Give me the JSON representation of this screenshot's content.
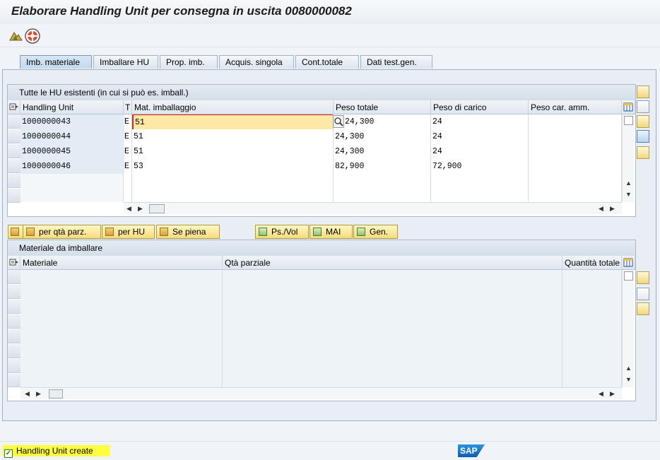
{
  "window": {
    "title": "Elaborare Handling Unit per consegna in uscita 0080000082"
  },
  "toolbar": {
    "icons": [
      "mountain-icon",
      "lifebuoy-icon"
    ]
  },
  "tabs": [
    {
      "label": "Imb. materiale",
      "active": true
    },
    {
      "label": "Imballare HU"
    },
    {
      "label": "Prop. imb."
    },
    {
      "label": "Acquis. singola"
    },
    {
      "label": "Cont.totale"
    },
    {
      "label": "Dati test.gen."
    }
  ],
  "hu_table": {
    "title": "Tutte le HU esistenti (in cui si può es. imball.)",
    "columns": [
      "Handling Unit",
      "T",
      "Mat. imballaggio",
      "Peso totale",
      "Peso di carico",
      "Peso car. amm."
    ],
    "rows": [
      {
        "hu": "1000000043",
        "t": "E",
        "mat": "51",
        "peso_totale": "24,300",
        "peso_carico": "24",
        "peso_amm": ""
      },
      {
        "hu": "1000000044",
        "t": "E",
        "mat": "51",
        "peso_totale": "24,300",
        "peso_carico": "24",
        "peso_amm": ""
      },
      {
        "hu": "1000000045",
        "t": "E",
        "mat": "51",
        "peso_totale": "24,300",
        "peso_carico": "24",
        "peso_amm": ""
      },
      {
        "hu": "1000000046",
        "t": "E",
        "mat": "53",
        "peso_totale": "82,900",
        "peso_carico": "72,900",
        "peso_amm": ""
      }
    ]
  },
  "buttons": {
    "per_qta_parz": "per qtà parz.",
    "per_hu": "per HU",
    "se_piena": "Se piena",
    "ps_vol": "Ps./Vol",
    "mai": "MAI",
    "gen": "Gen."
  },
  "mat_table": {
    "title": "Materiale da imballare",
    "columns": [
      "Materiale",
      "Qtà parziale",
      "Quantità totale"
    ]
  },
  "status": {
    "message": "Handling Unit create"
  },
  "brand": {
    "logo": "SAP"
  },
  "colors": {
    "status_highlight": "#ffff40",
    "active_cell": "#fde9a5",
    "hu_cell": "#e3ecf5"
  }
}
